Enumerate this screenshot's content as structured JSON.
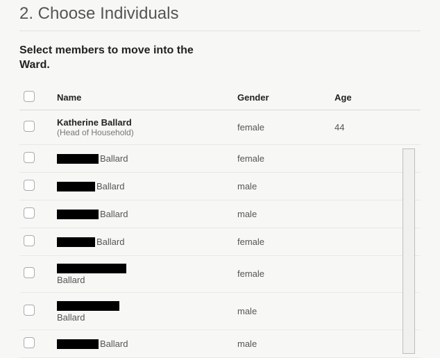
{
  "step": {
    "title": "2. Choose Individuals",
    "instruction": "Select members to move into the Ward."
  },
  "table": {
    "headers": {
      "name": "Name",
      "gender": "Gender",
      "age": "Age"
    },
    "rows": [
      {
        "name_primary": "Katherine Ballard",
        "name_secondary": "(Head of Household)",
        "redacted": false,
        "gender": "female",
        "age": "44"
      },
      {
        "surname": "Ballard",
        "redacted": true,
        "redact_style": "w1",
        "layout": "inline",
        "gender": "female",
        "age": ""
      },
      {
        "surname": "Ballard",
        "redacted": true,
        "redact_style": "w2",
        "layout": "inline",
        "gender": "male",
        "age": ""
      },
      {
        "surname": "Ballard",
        "redacted": true,
        "redact_style": "w1",
        "layout": "inline",
        "gender": "male",
        "age": ""
      },
      {
        "surname": "Ballard",
        "redacted": true,
        "redact_style": "w2",
        "layout": "inline",
        "gender": "female",
        "age": ""
      },
      {
        "surname": "Ballard",
        "redacted": true,
        "redact_style": "w3",
        "layout": "below",
        "gender": "female",
        "age": ""
      },
      {
        "surname": "Ballard",
        "redacted": true,
        "redact_style": "w4",
        "layout": "below",
        "gender": "male",
        "age": ""
      },
      {
        "surname": "Ballard",
        "redacted": true,
        "redact_style": "w1",
        "layout": "inline",
        "gender": "male",
        "age": ""
      }
    ]
  }
}
